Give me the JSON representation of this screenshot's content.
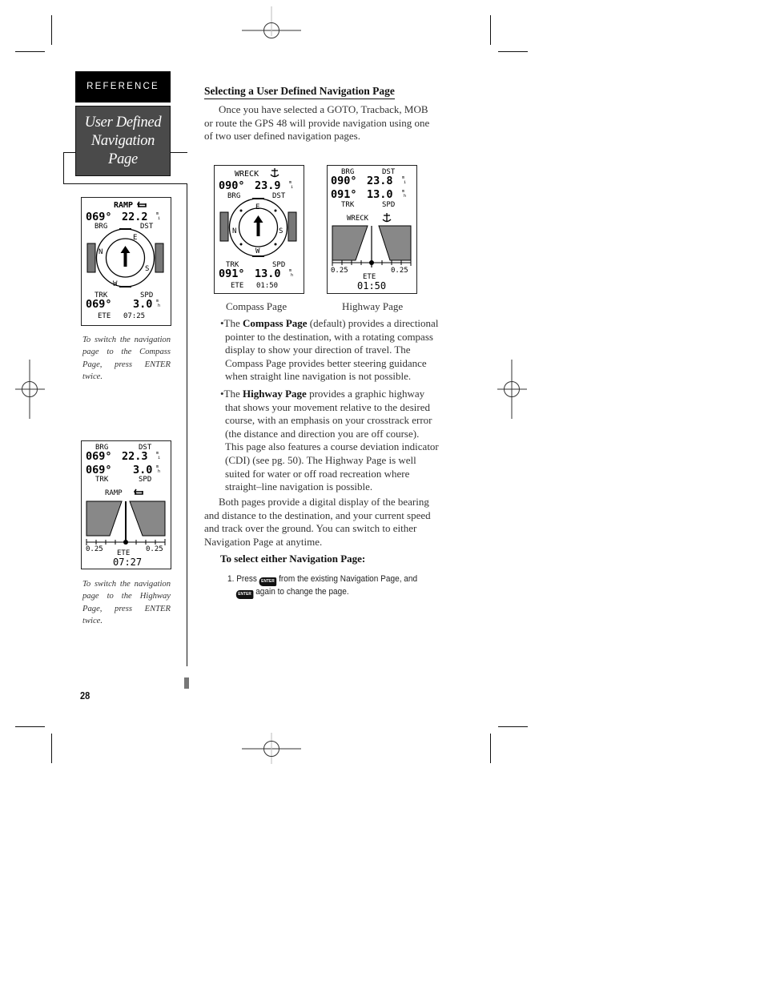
{
  "section_tab": "REFERENCE",
  "page_title_line1": "User Defined",
  "page_title_line2": "Navigation Page",
  "page_number": "28",
  "sidebar": {
    "screen1": {
      "waypoint": "RAMP",
      "waypoint_icon": "boat-ramp-icon",
      "bearing": "069°",
      "distance": "22.2",
      "distance_unit": "mi",
      "brg_label": "BRG",
      "dst_label": "DST",
      "compass": [
        "E",
        "S",
        "W",
        "N"
      ],
      "trk_label": "TRK",
      "spd_label": "SPD",
      "track": "069°",
      "speed": "3.0",
      "speed_unit": "mh",
      "ete_label": "ETE",
      "ete": "07:25"
    },
    "caption1": "To switch the navigation page to the Compass Page, press ENTER twice.",
    "screen2": {
      "brg_label": "BRG",
      "dst_label": "DST",
      "bearing": "069°",
      "distance": "22.3",
      "distance_unit": "mi",
      "track": "069°",
      "speed": "3.0",
      "speed_unit": "mh",
      "trk_label": "TRK",
      "spd_label": "SPD",
      "waypoint": "RAMP",
      "waypoint_icon": "boat-ramp-icon",
      "scale_left": "0.25",
      "scale_right": "0.25",
      "ete_label": "ETE",
      "ete": "07:27"
    },
    "caption2": "To switch the navigation page to the Highway Page, press ENTER twice."
  },
  "main": {
    "heading": "Selecting a User Defined Navigation Page",
    "intro": "Once you have selected a GOTO, Tracback, MOB or route the GPS 48 will provide navigation using one of two user defined navigation pages.",
    "compass_screen": {
      "waypoint": "WRECK",
      "waypoint_icon": "anchor-icon",
      "bearing": "090°",
      "distance": "23.9",
      "distance_unit": "mi",
      "brg_label": "BRG",
      "dst_label": "DST",
      "compass": [
        "E",
        "S",
        "W",
        "N"
      ],
      "trk_label": "TRK",
      "spd_label": "SPD",
      "track": "091°",
      "speed": "13.0",
      "speed_unit": "mh",
      "ete_label": "ETE",
      "ete": "01:50"
    },
    "highway_screen": {
      "brg_label": "BRG",
      "dst_label": "DST",
      "bearing": "090°",
      "distance": "23.8",
      "distance_unit": "mi",
      "track": "091°",
      "speed": "13.0",
      "speed_unit": "mh",
      "trk_label": "TRK",
      "spd_label": "SPD",
      "waypoint": "WRECK",
      "waypoint_icon": "anchor-icon",
      "scale_left": "0.25",
      "scale_right": "0.25",
      "ete_label": "ETE",
      "ete": "01:50"
    },
    "compass_caption": "Compass Page",
    "highway_caption": "Highway Page",
    "bullet1_prefix": "•The ",
    "bullet1_bold": "Compass Page",
    "bullet1_text": " (default) provides a directional pointer to the destination, with a rotating compass display to show your direction of travel. The Compass Page provides better steering guidance when straight line navigation is not possible.",
    "bullet2_prefix": "•The ",
    "bullet2_bold": "Highway Page",
    "bullet2_text": " provides a graphic highway that shows your movement relative to the desired course, with an emphasis on your crosstrack error (the distance and direction you are off course). This page also features a course deviation indicator (CDI) (see pg. 50).  The Highway Page is well suited for water or off road recreation where straight–line navigation is possible.",
    "summary": "Both pages provide a digital display of the bearing and distance to the destination, and your current speed and track over the ground.  You can switch to either Navigation Page at anytime.",
    "procedure_heading": "To select either Navigation Page:",
    "step1_a": "1. Press ",
    "step1_b": " from the existing Navigation Page, and",
    "step1_c": " again to change the page.",
    "enter_key_label": "ENTER"
  }
}
